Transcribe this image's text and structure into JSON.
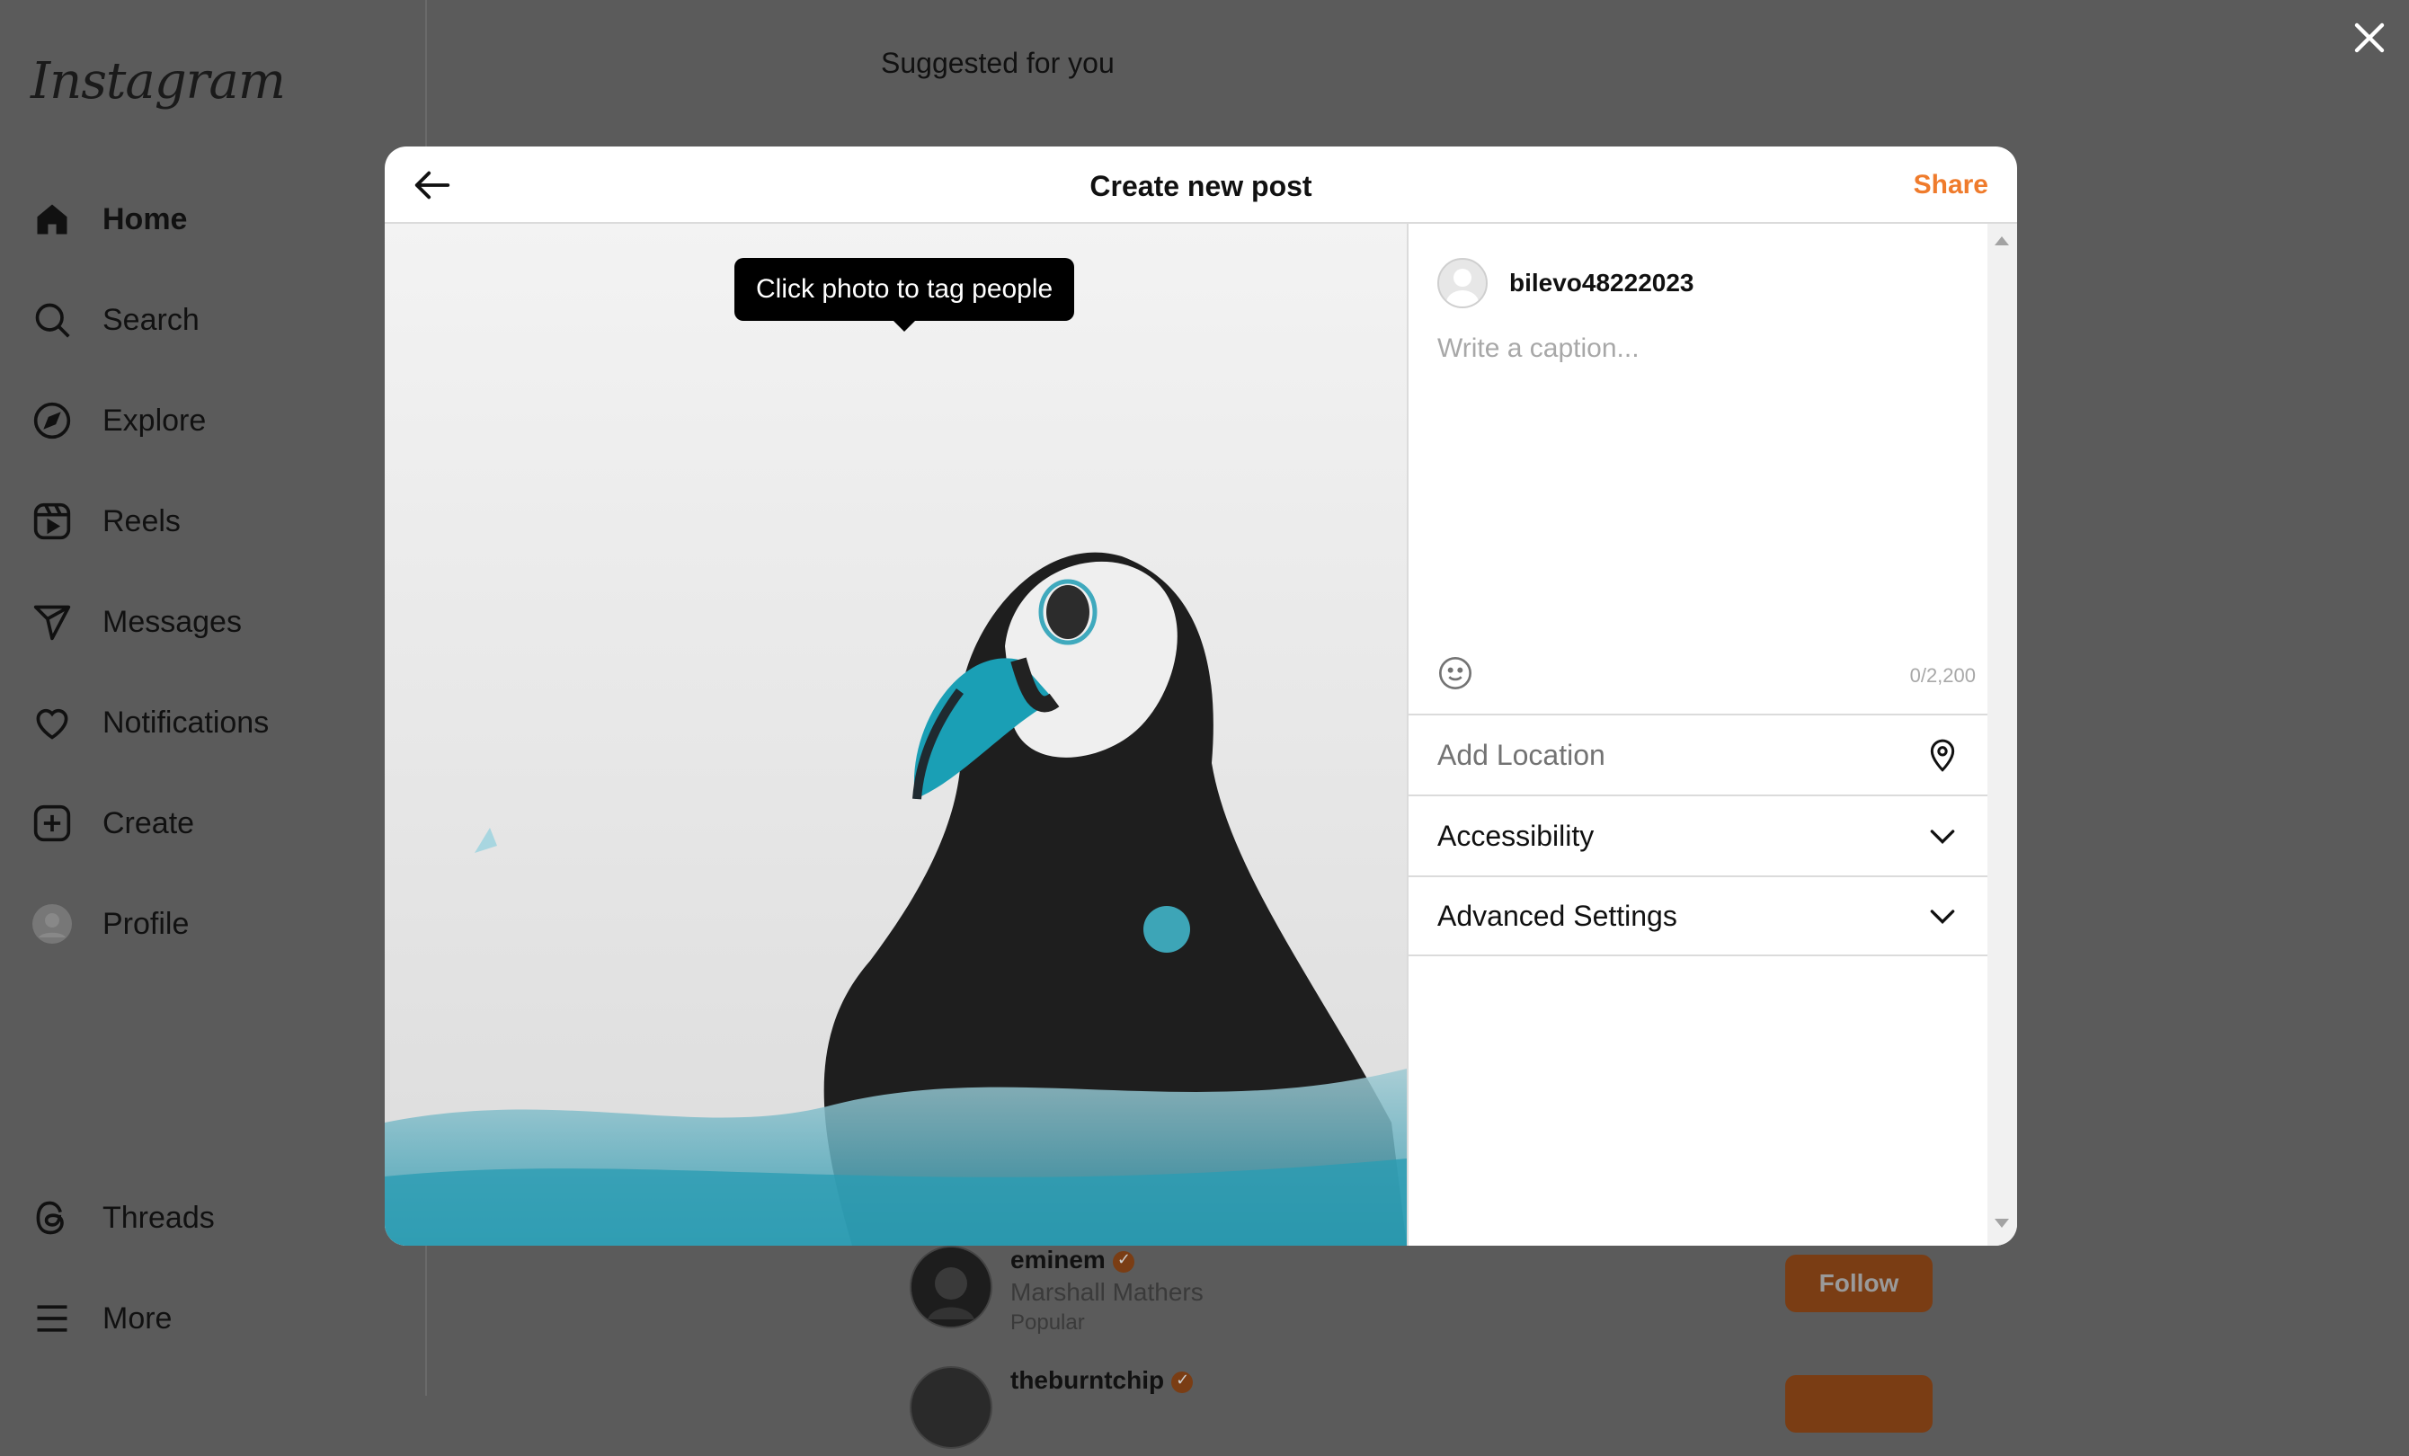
{
  "app": {
    "logo": "Instagram"
  },
  "sidebar": {
    "items": [
      {
        "label": "Home",
        "icon": "home-icon"
      },
      {
        "label": "Search",
        "icon": "search-icon"
      },
      {
        "label": "Explore",
        "icon": "compass-icon"
      },
      {
        "label": "Reels",
        "icon": "reels-icon"
      },
      {
        "label": "Messages",
        "icon": "send-icon"
      },
      {
        "label": "Notifications",
        "icon": "heart-icon"
      },
      {
        "label": "Create",
        "icon": "plus-square-icon"
      },
      {
        "label": "Profile",
        "icon": "avatar-icon"
      }
    ],
    "bottom_items": [
      {
        "label": "Threads",
        "icon": "threads-icon"
      },
      {
        "label": "More",
        "icon": "menu-icon"
      }
    ]
  },
  "feed": {
    "suggested_title": "Suggested for you",
    "suggestions": [
      {
        "username": "eminem",
        "full_name": "Marshall Mathers",
        "tag": "Popular",
        "follow_label": "Follow",
        "verified": true
      },
      {
        "username": "theburntchip",
        "full_name": "",
        "tag": "",
        "follow_label": "",
        "verified": true
      }
    ]
  },
  "modal": {
    "title": "Create new post",
    "share_label": "Share",
    "tooltip": "Click photo to tag people",
    "photo_subject": "puffin",
    "username": "bilevo48222023",
    "caption_placeholder": "Write a caption...",
    "caption_value": "",
    "char_count": "0/2,200",
    "add_location_placeholder": "Add Location",
    "accessibility_label": "Accessibility",
    "advanced_settings_label": "Advanced Settings"
  },
  "colors": {
    "accent": "#ef7b2c",
    "overlay": "#5b5b5b",
    "follow_button": "#7a3d14",
    "puffin_beak": "#1a9fb5"
  }
}
